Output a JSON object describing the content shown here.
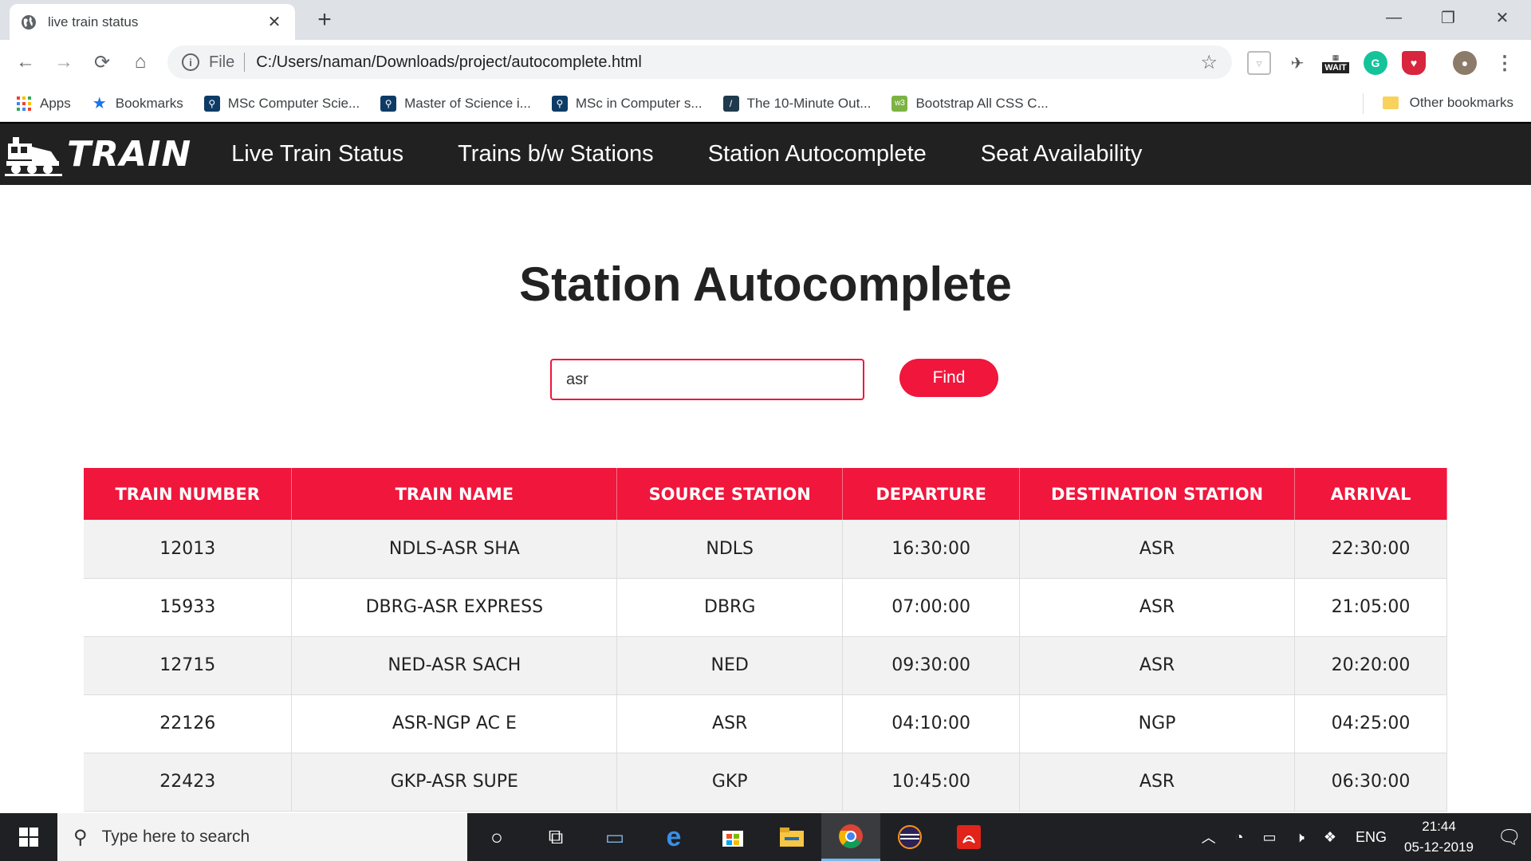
{
  "browser": {
    "tab_title": "live train status",
    "address_scheme": "File",
    "address_url": "C:/Users/naman/Downloads/project/autocomplete.html",
    "extension_wait_label": "WAIT",
    "bookmarks": [
      {
        "label": "Apps",
        "icon": "apps-grid-icon"
      },
      {
        "label": "Bookmarks",
        "icon": "star-icon"
      },
      {
        "label": "MSc Computer Scie...",
        "icon": "shield-icon"
      },
      {
        "label": "Master of Science i...",
        "icon": "shield-icon"
      },
      {
        "label": "MSc in Computer s...",
        "icon": "shield-icon"
      },
      {
        "label": "The 10-Minute Out...",
        "icon": "slash-icon"
      },
      {
        "label": "Bootstrap All CSS C...",
        "icon": "code-icon"
      }
    ],
    "other_bookmarks": "Other bookmarks"
  },
  "site": {
    "brand": "TRAIN",
    "nav": [
      "Live Train Status",
      "Trains b/w Stations",
      "Station Autocomplete",
      "Seat Availability"
    ],
    "title": "Station Autocomplete",
    "search": {
      "value": "asr",
      "button": "Find"
    },
    "accent_color": "#f0163c",
    "table": {
      "headers": [
        "TRAIN NUMBER",
        "TRAIN NAME",
        "SOURCE STATION",
        "DEPARTURE",
        "DESTINATION STATION",
        "ARRIVAL"
      ],
      "rows": [
        [
          "12013",
          "NDLS-ASR SHA",
          "NDLS",
          "16:30:00",
          "ASR",
          "22:30:00"
        ],
        [
          "15933",
          "DBRG-ASR EXPRESS",
          "DBRG",
          "07:00:00",
          "ASR",
          "21:05:00"
        ],
        [
          "12715",
          "NED-ASR SACH",
          "NED",
          "09:30:00",
          "ASR",
          "20:20:00"
        ],
        [
          "22126",
          "ASR-NGP AC E",
          "ASR",
          "04:10:00",
          "NGP",
          "04:25:00"
        ],
        [
          "22423",
          "GKP-ASR SUPE",
          "GKP",
          "10:45:00",
          "ASR",
          "06:30:00"
        ]
      ]
    }
  },
  "taskbar": {
    "search_placeholder": "Type here to search",
    "language": "ENG",
    "time": "21:44",
    "date": "05-12-2019"
  }
}
